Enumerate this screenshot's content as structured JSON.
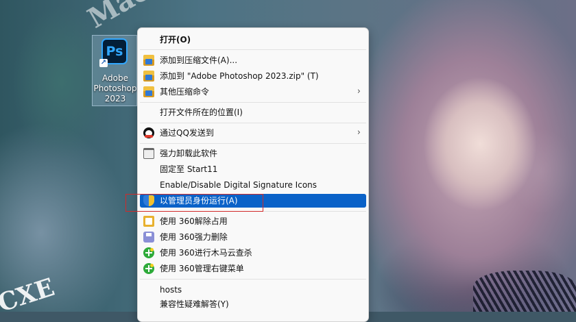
{
  "desktop": {
    "icon": {
      "label_lines": [
        "Adobe",
        "Photoshop",
        "2023"
      ],
      "tile_text": "Ps",
      "accent": "#31a8ff"
    }
  },
  "watermarks": {
    "top": "Mac",
    "diagonal": "Mac.com",
    "bottom_left": "CXE"
  },
  "context_menu": {
    "items": [
      {
        "label": "打开(O)",
        "icon": null,
        "bold": true
      },
      {
        "label": "添加到压缩文件(A)...",
        "icon": "archive-icon"
      },
      {
        "label": "添加到 \"Adobe Photoshop 2023.zip\" (T)",
        "icon": "archive-icon"
      },
      {
        "label": "其他压缩命令",
        "icon": "archive-icon",
        "submenu": true
      },
      {
        "label": "打开文件所在的位置(I)",
        "icon": null
      },
      {
        "label": "通过QQ发送到",
        "icon": "qq-icon",
        "submenu": true
      },
      {
        "label": "强力卸载此软件",
        "icon": "trash-icon"
      },
      {
        "label": "固定至 Start11",
        "icon": null
      },
      {
        "label": "Enable/Disable Digital Signature Icons",
        "icon": null
      },
      {
        "label": "以管理员身份运行(A)",
        "icon": "admin-shield-icon",
        "highlighted": true
      },
      {
        "label": "使用 360解除占用",
        "icon": "unlock-360-icon"
      },
      {
        "label": "使用 360强力删除",
        "icon": "delete-360-icon"
      },
      {
        "label": "使用 360进行木马云查杀",
        "icon": "scan-360-icon"
      },
      {
        "label": "使用 360管理右键菜单",
        "icon": "menu-360-icon"
      },
      {
        "label": "hosts",
        "icon": null
      },
      {
        "label": "兼容性疑难解答(Y)",
        "icon": null
      }
    ],
    "highlight_color": "#0a62c8",
    "annotation_color": "#d12a2a"
  }
}
